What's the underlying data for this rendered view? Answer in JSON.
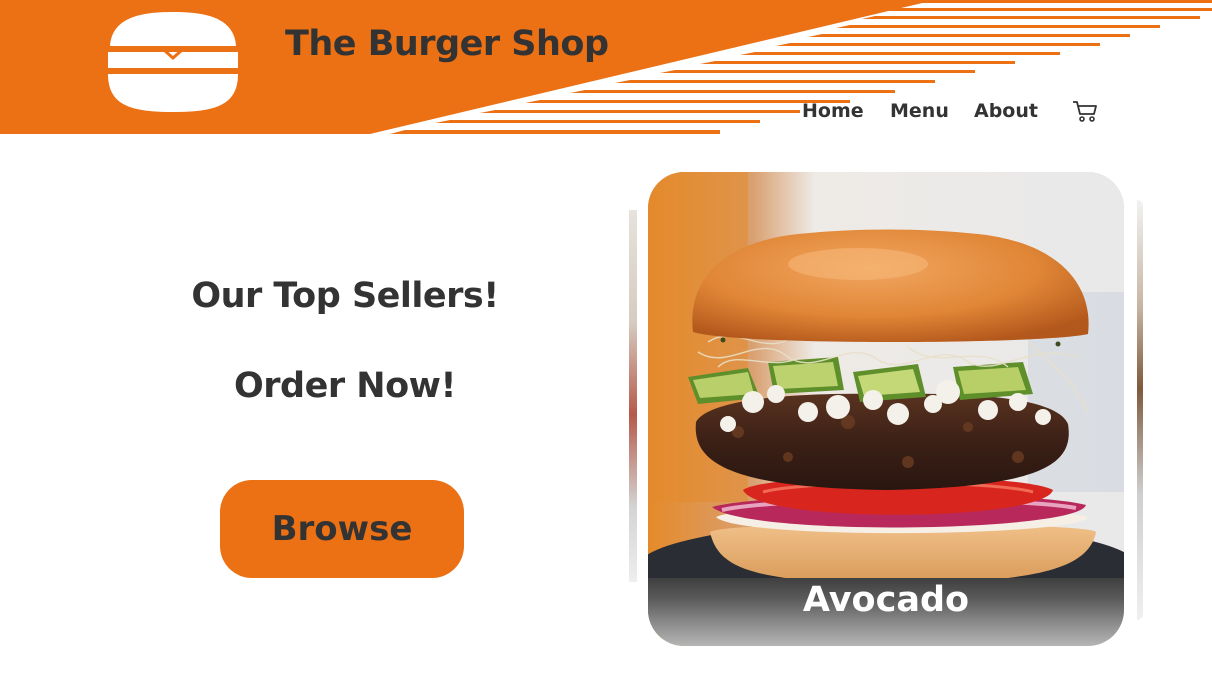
{
  "header": {
    "brand": "The Burger Shop",
    "logo_icon": "burger-icon",
    "accent_color": "#ec7014",
    "nav": [
      {
        "label": "Home"
      },
      {
        "label": "Menu"
      },
      {
        "label": "About"
      }
    ],
    "cart_icon": "cart-icon"
  },
  "hero": {
    "headline_1": "Our Top Sellers!",
    "headline_2": "Order Now!",
    "browse_label": "Browse",
    "button_color": "#ec7014"
  },
  "carousel": {
    "current_item": {
      "label": "Avocado",
      "image": "avocado-burger-photo"
    }
  }
}
